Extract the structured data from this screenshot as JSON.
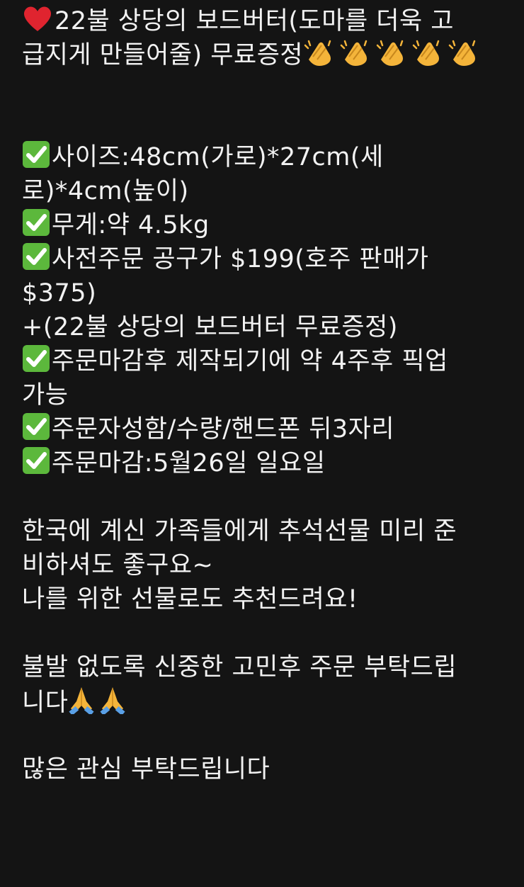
{
  "post": {
    "lines": [
      {
        "text": "22불 상당의 보드버터(도마를 더욱 고",
        "icon": "heart"
      },
      {
        "text": "급지게 만들어줄) 무료증정",
        "trail": "clap",
        "trail_count": 5
      },
      {
        "gap": true
      },
      {
        "gap": true
      },
      {
        "text": "사이즈:48cm(가로)*27cm(세",
        "icon": "check"
      },
      {
        "text": "로)*4cm(높이)"
      },
      {
        "text": "무게:약 4.5kg",
        "icon": "check"
      },
      {
        "text": "사전주문 공구가 $199(호주 판매가",
        "icon": "check"
      },
      {
        "text": "$375)"
      },
      {
        "text": "+(22불 상당의 보드버터 무료증정)"
      },
      {
        "text": "주문마감후 제작되기에 약 4주후 픽업",
        "icon": "check"
      },
      {
        "text": "가능"
      },
      {
        "text": "주문자성함/수량/핸드폰 뒤3자리",
        "icon": "check"
      },
      {
        "text": "주문마감:5월26일 일요일",
        "icon": "check"
      },
      {
        "gap": true
      },
      {
        "text": "한국에 계신 가족들에게 추석선물 미리 준"
      },
      {
        "text": "비하셔도 좋구요~"
      },
      {
        "text": "나를 위한 선물로도 추천드려요!"
      },
      {
        "gap": true
      },
      {
        "text": "불발 없도록 신중한 고민후 주문 부탁드립"
      },
      {
        "text": "니다",
        "trail": "pray",
        "trail_count": 2
      },
      {
        "gap": true
      },
      {
        "text": "많은 관심 부탁드립니다"
      }
    ]
  },
  "colors": {
    "background": "#141414",
    "text": "#f2f2f2",
    "check_green": "#5cb83c",
    "heart_red": "#e0242f",
    "clap_yellow": "#f4b43a",
    "pray_blue": "#5aa0e6"
  }
}
